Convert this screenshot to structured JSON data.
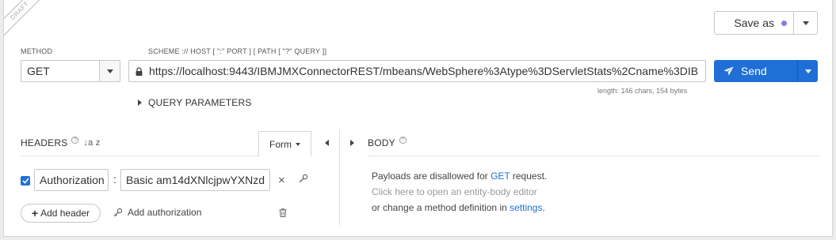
{
  "ribbon": {
    "label": "DRAFT"
  },
  "toolbar": {
    "save_as_label": "Save as",
    "dot_color": "#8c7ce8"
  },
  "request": {
    "method_label": "METHOD",
    "method_value": "GET",
    "url_label": "SCHEME :// HOST [ \":\" PORT ] [ PATH [ \"?\" QUERY ]]",
    "url_value": "https://localhost:9443/IBMJMXConnectorREST/mbeans/WebSphere%3Atype%3DServletStats%2Cname%3DIB",
    "length_info": "length: 146 chars, 154 bytes",
    "send_label": "Send",
    "accent_color": "#1f6fd6"
  },
  "query": {
    "label": "QUERY PARAMETERS"
  },
  "headers": {
    "title": "HEADERS",
    "help_glyph": "?",
    "sort_glyph": "↓a z",
    "form_label": "Form",
    "rows": [
      {
        "enabled": true,
        "name": "Authorization",
        "separator": ":",
        "value": "Basic am14dXNlcjpwYXNzd"
      }
    ],
    "remove_glyph": "×",
    "add_header_plus": "+",
    "add_header_label": "Add header",
    "add_authorization_label": "Add authorization"
  },
  "body": {
    "title": "BODY",
    "help_glyph": "?",
    "line1_pre": "Payloads are disallowed for ",
    "line1_method": "GET",
    "line1_post": " request.",
    "line2": "Click here to open an entity-body editor",
    "line3_pre": "or change a method definition in ",
    "line3_link": "settings",
    "line3_post": "."
  }
}
